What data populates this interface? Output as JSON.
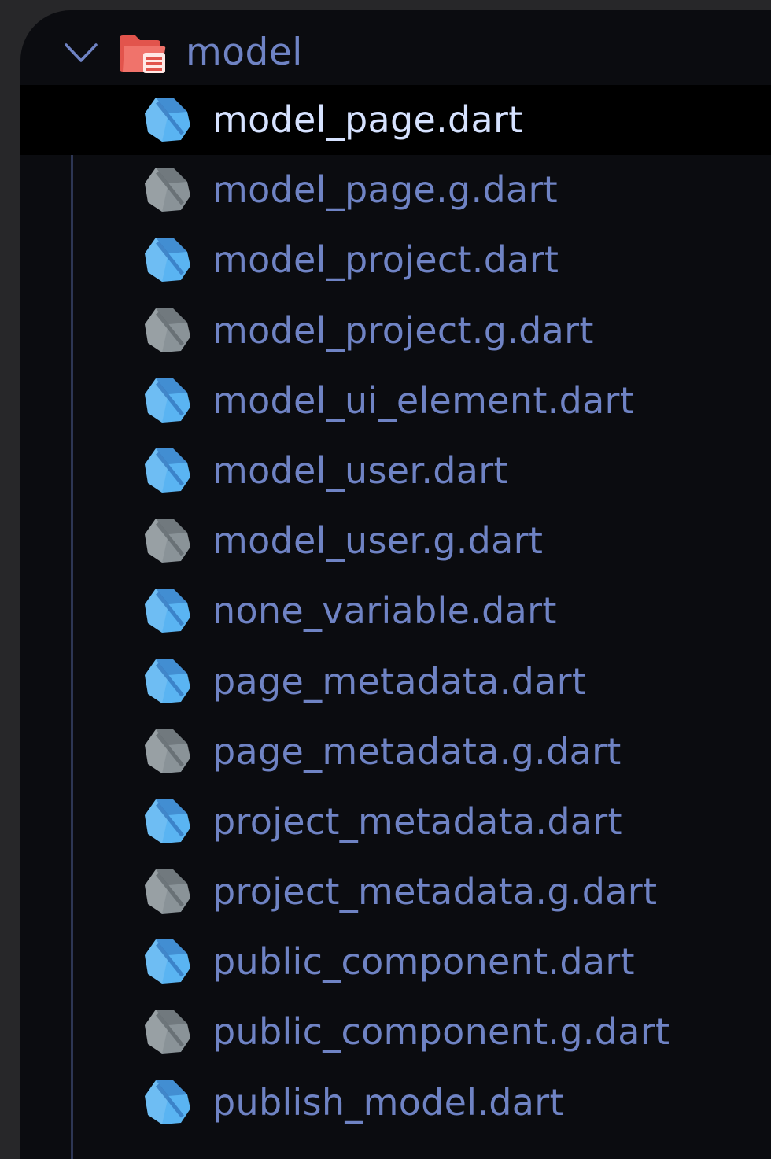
{
  "explorer": {
    "folder": {
      "label": "model",
      "expanded": true,
      "icon": "folder-open-icon",
      "icon_color": "#e2544c"
    },
    "colors": {
      "dart_icon": "#5ab4f2",
      "generated_icon": "#8a9398",
      "label": "#6f83c4",
      "selected_label": "#d6e2ff",
      "background": "#0b0c10"
    },
    "files": [
      {
        "label": "model_page.dart",
        "generated": false,
        "selected": true
      },
      {
        "label": "model_page.g.dart",
        "generated": true,
        "selected": false
      },
      {
        "label": "model_project.dart",
        "generated": false,
        "selected": false
      },
      {
        "label": "model_project.g.dart",
        "generated": true,
        "selected": false
      },
      {
        "label": "model_ui_element.dart",
        "generated": false,
        "selected": false
      },
      {
        "label": "model_user.dart",
        "generated": false,
        "selected": false
      },
      {
        "label": "model_user.g.dart",
        "generated": true,
        "selected": false
      },
      {
        "label": "none_variable.dart",
        "generated": false,
        "selected": false
      },
      {
        "label": "page_metadata.dart",
        "generated": false,
        "selected": false
      },
      {
        "label": "page_metadata.g.dart",
        "generated": true,
        "selected": false
      },
      {
        "label": "project_metadata.dart",
        "generated": false,
        "selected": false
      },
      {
        "label": "project_metadata.g.dart",
        "generated": true,
        "selected": false
      },
      {
        "label": "public_component.dart",
        "generated": false,
        "selected": false
      },
      {
        "label": "public_component.g.dart",
        "generated": true,
        "selected": false
      },
      {
        "label": "publish_model.dart",
        "generated": false,
        "selected": false
      }
    ]
  }
}
